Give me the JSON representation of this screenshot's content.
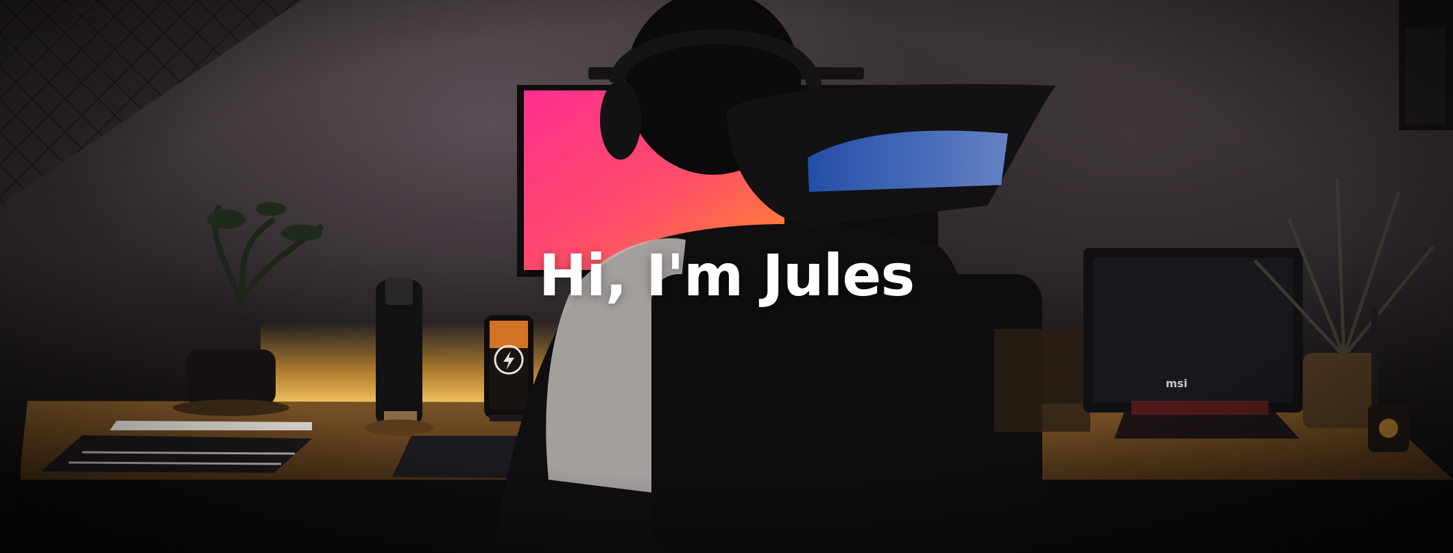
{
  "hero": {
    "title": "Hi, I'm Jules"
  },
  "photo": {
    "subject": "person-at-desk-setup",
    "colors": {
      "wall": "#3a3437",
      "desk": "#6e4a23",
      "desk_glow": "#ffb43a",
      "monitor_pink": "#ff2f8e",
      "monitor_orange": "#ff7a2a",
      "screen_blue": "#3a7bff",
      "shadow": "#0b0a0c"
    },
    "screen_labels": {
      "laptop_brand": "msi"
    }
  }
}
